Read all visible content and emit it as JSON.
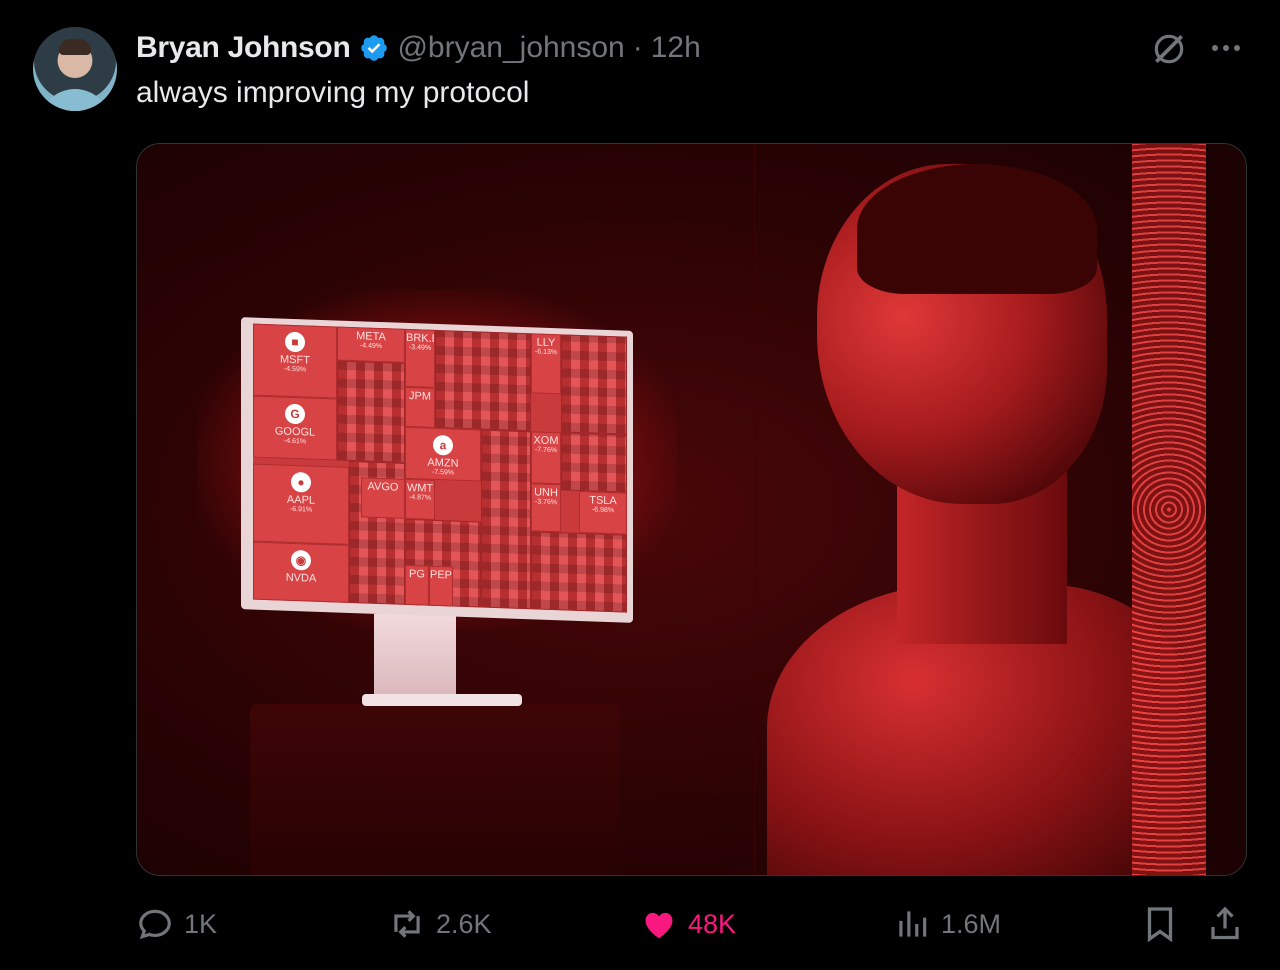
{
  "author": {
    "name": "Bryan Johnson",
    "handle": "@bryan_johnson",
    "separator": "·",
    "time": "12h",
    "verified": true
  },
  "tweet": {
    "text": "always improving my protocol"
  },
  "media": {
    "screen_tiles": [
      {
        "symbol": "MSFT",
        "change": "-4.59%"
      },
      {
        "symbol": "GOOGL",
        "change": "-4.61%"
      },
      {
        "symbol": "AAPL",
        "change": "-6.91%"
      },
      {
        "symbol": "NVDA",
        "change": ""
      },
      {
        "symbol": "META",
        "change": "-4.49%"
      },
      {
        "symbol": "BRK.B",
        "change": "-3.49%"
      },
      {
        "symbol": "JPM",
        "change": ""
      },
      {
        "symbol": "AMZN",
        "change": "-7.59%"
      },
      {
        "symbol": "LLY",
        "change": "-6.13%"
      },
      {
        "symbol": "XOM",
        "change": "-7.76%"
      },
      {
        "symbol": "UNH",
        "change": "-3.76%"
      },
      {
        "symbol": "TSLA",
        "change": "-6.98%"
      },
      {
        "symbol": "WMT",
        "change": "-4.87%"
      },
      {
        "symbol": "AVGO",
        "change": ""
      },
      {
        "symbol": "PG",
        "change": ""
      },
      {
        "symbol": "PEP",
        "change": ""
      }
    ]
  },
  "actions": {
    "reply_count": "1K",
    "repost_count": "2.6K",
    "like_count": "48K",
    "view_count": "1.6M"
  },
  "colors": {
    "background": "#000000",
    "text_primary": "#e7e9ea",
    "text_secondary": "#71767b",
    "verified_blue": "#1d9bf0",
    "like_pink": "#f91880"
  },
  "icons": {
    "grok": "grok-icon",
    "more": "more-icon",
    "reply": "reply-icon",
    "repost": "repost-icon",
    "like": "heart-icon",
    "views": "views-icon",
    "bookmark": "bookmark-icon",
    "share": "share-icon"
  }
}
